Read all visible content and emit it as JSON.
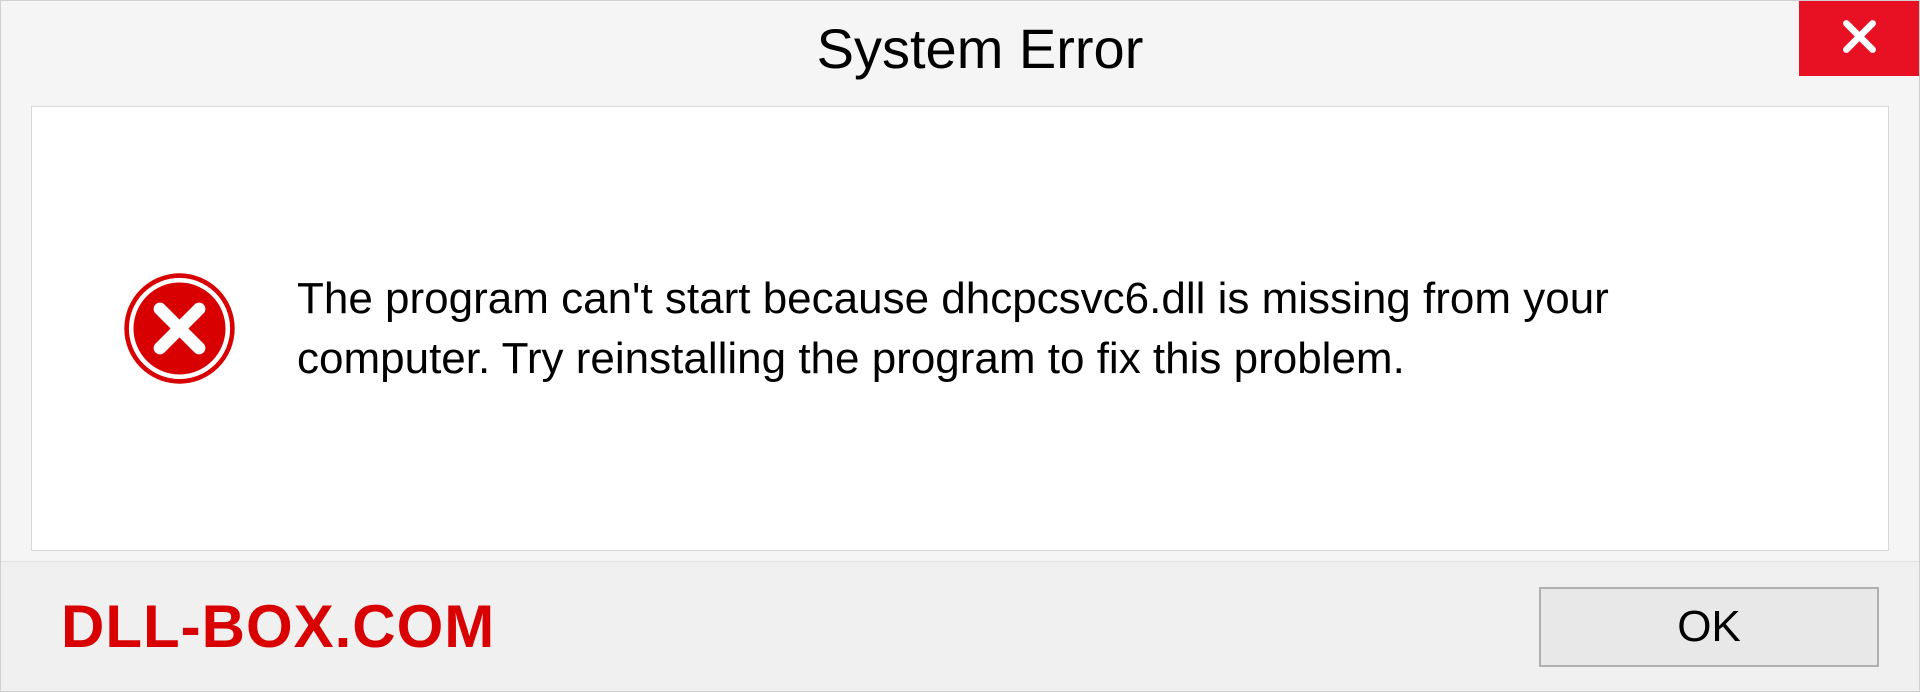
{
  "titlebar": {
    "title": "System Error"
  },
  "content": {
    "message": "The program can't start because dhcpcsvc6.dll is missing from your computer. Try reinstalling the program to fix this problem."
  },
  "footer": {
    "watermark": "DLL-BOX.COM",
    "ok_label": "OK"
  }
}
